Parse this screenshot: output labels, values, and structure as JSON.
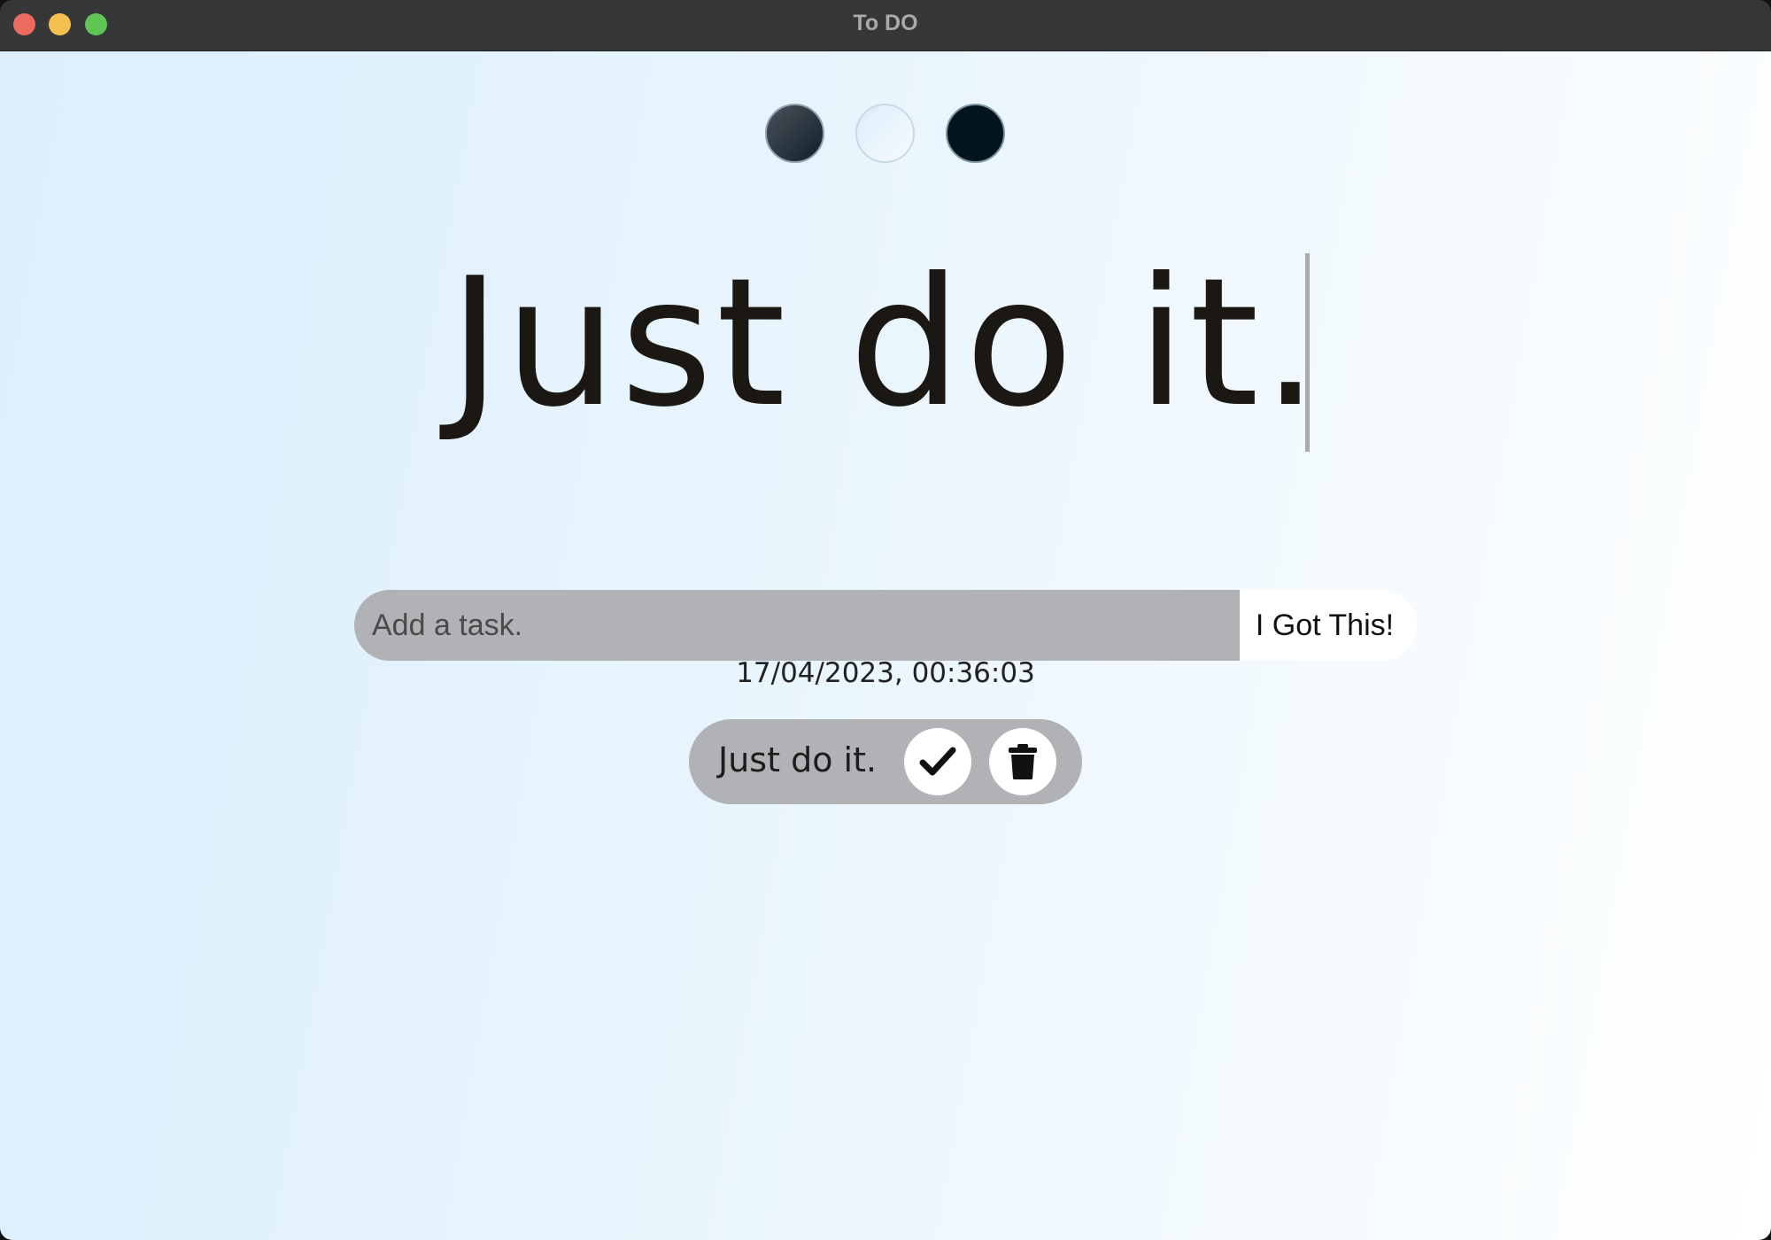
{
  "window": {
    "title": "To DO"
  },
  "themes": [
    {
      "name": "standard",
      "color": "#1b2a36"
    },
    {
      "name": "light",
      "color": "#e6f3fc"
    },
    {
      "name": "darker",
      "color": "#03141d"
    }
  ],
  "heading": "Just do it.",
  "form": {
    "placeholder": "Add a task.",
    "button_label": "I Got This!"
  },
  "datetime": "17/04/2023, 00:36:03",
  "todos": [
    {
      "text": "Just do it.",
      "check_icon": "check-icon",
      "delete_icon": "trash-icon"
    }
  ],
  "colors": {
    "input_bg": "#b0b2b5",
    "heading_text": "#1b1813",
    "gradient_start": "#dbeffd",
    "gradient_end": "#ffffff"
  }
}
